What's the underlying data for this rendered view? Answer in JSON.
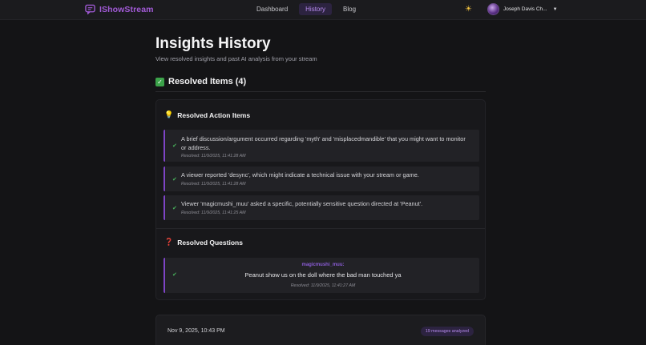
{
  "app": {
    "name": "IShowStream"
  },
  "nav": [
    {
      "label": "Dashboard",
      "active": false
    },
    {
      "label": "History",
      "active": true
    },
    {
      "label": "Blog",
      "active": false
    }
  ],
  "theme_toggle": {
    "icon": "sun-icon",
    "glyph": "☀"
  },
  "user": {
    "name": "Joseph Davis Ch...",
    "caret": "▼"
  },
  "page": {
    "title": "Insights History",
    "subtitle": "View resolved insights and past AI analysis from your stream"
  },
  "resolved": {
    "icon_glyph": "✓",
    "title": "Resolved Items (4)",
    "action_items": {
      "icon_glyph": "💡",
      "title": "Resolved Action Items",
      "items": [
        {
          "text": "A brief discussion/argument occurred regarding 'myth' and 'misplacedmandible' that you might want to monitor or address.",
          "resolved": "Resolved: 11/9/2025, 11:41:28 AM"
        },
        {
          "text": "A viewer reported 'desync', which might indicate a technical issue with your stream or game.",
          "resolved": "Resolved: 11/9/2025, 11:41:28 AM"
        },
        {
          "text": "Viewer 'magicmushi_muu' asked a specific, potentially sensitive question directed at 'Peanut'.",
          "resolved": "Resolved: 11/9/2025, 11:41:25 AM"
        }
      ]
    },
    "questions": {
      "icon_glyph": "❓",
      "title": "Resolved Questions",
      "items": [
        {
          "user": "magicmushi_muu:",
          "text": "Peanut show us on the doll where the bad man touched ya",
          "resolved": "Resolved: 11/9/2025, 11:41:27 AM"
        }
      ]
    }
  },
  "history_card": {
    "date": "Nov 9, 2025, 10:43 PM",
    "badge": "19 messages analyzed"
  },
  "check_glyph": "✔",
  "colors": {
    "accent": "#a35bd8",
    "success": "#3ca34a",
    "bg": "#141416"
  }
}
